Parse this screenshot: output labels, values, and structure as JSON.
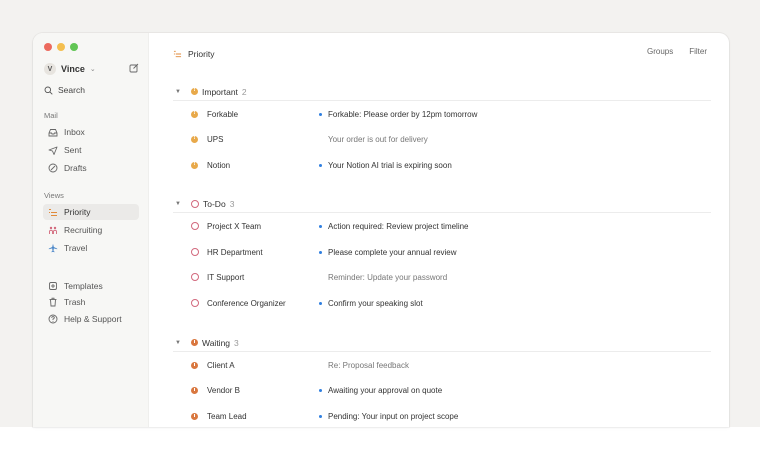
{
  "sidebar": {
    "account": {
      "initial": "V",
      "name": "Vince"
    },
    "search_label": "Search",
    "mail_label": "Mail",
    "mail_items": [
      {
        "label": "Inbox",
        "icon": "inbox-icon"
      },
      {
        "label": "Sent",
        "icon": "send-icon"
      },
      {
        "label": "Drafts",
        "icon": "drafts-icon"
      }
    ],
    "views_label": "Views",
    "view_items": [
      {
        "label": "Priority",
        "icon": "priority-icon",
        "active": true
      },
      {
        "label": "Recruiting",
        "icon": "people-icon"
      },
      {
        "label": "Travel",
        "icon": "plane-icon"
      }
    ],
    "footer_items": [
      {
        "label": "Templates",
        "icon": "templates-icon"
      },
      {
        "label": "Trash",
        "icon": "trash-icon"
      },
      {
        "label": "Help & Support",
        "icon": "help-icon"
      }
    ]
  },
  "topbar": {
    "title": "Priority",
    "groups_label": "Groups",
    "filter_label": "Filter"
  },
  "groups": [
    {
      "name": "Important",
      "count": "2",
      "rows": [
        {
          "sender": "Forkable",
          "subject": "Forkable: Please order by 12pm tomorrow",
          "unread": true
        },
        {
          "sender": "UPS",
          "subject": "Your order is out for delivery",
          "unread": false
        },
        {
          "sender": "Notion",
          "subject": "Your Notion AI trial is expiring soon",
          "unread": true
        }
      ]
    },
    {
      "name": "To-Do",
      "count": "3",
      "rows": [
        {
          "sender": "Project X Team",
          "subject": "Action required: Review project timeline",
          "unread": true
        },
        {
          "sender": "HR Department",
          "subject": "Please complete your annual review",
          "unread": true
        },
        {
          "sender": "IT Support",
          "subject": "Reminder: Update your password",
          "unread": false
        },
        {
          "sender": "Conference Organizer",
          "subject": "Confirm your speaking slot",
          "unread": true
        }
      ]
    },
    {
      "name": "Waiting",
      "count": "3",
      "rows": [
        {
          "sender": "Client A",
          "subject": "Re: Proposal feedback",
          "unread": false
        },
        {
          "sender": "Vendor B",
          "subject": "Awaiting your approval on quote",
          "unread": true
        },
        {
          "sender": "Team Lead",
          "subject": "Pending: Your input on project scope",
          "unread": true
        }
      ]
    }
  ],
  "colors": {
    "unread_dot": "#2f7fe0",
    "important": "#e8a94a",
    "todo": "#d2697d",
    "waiting": "#d9773f"
  }
}
